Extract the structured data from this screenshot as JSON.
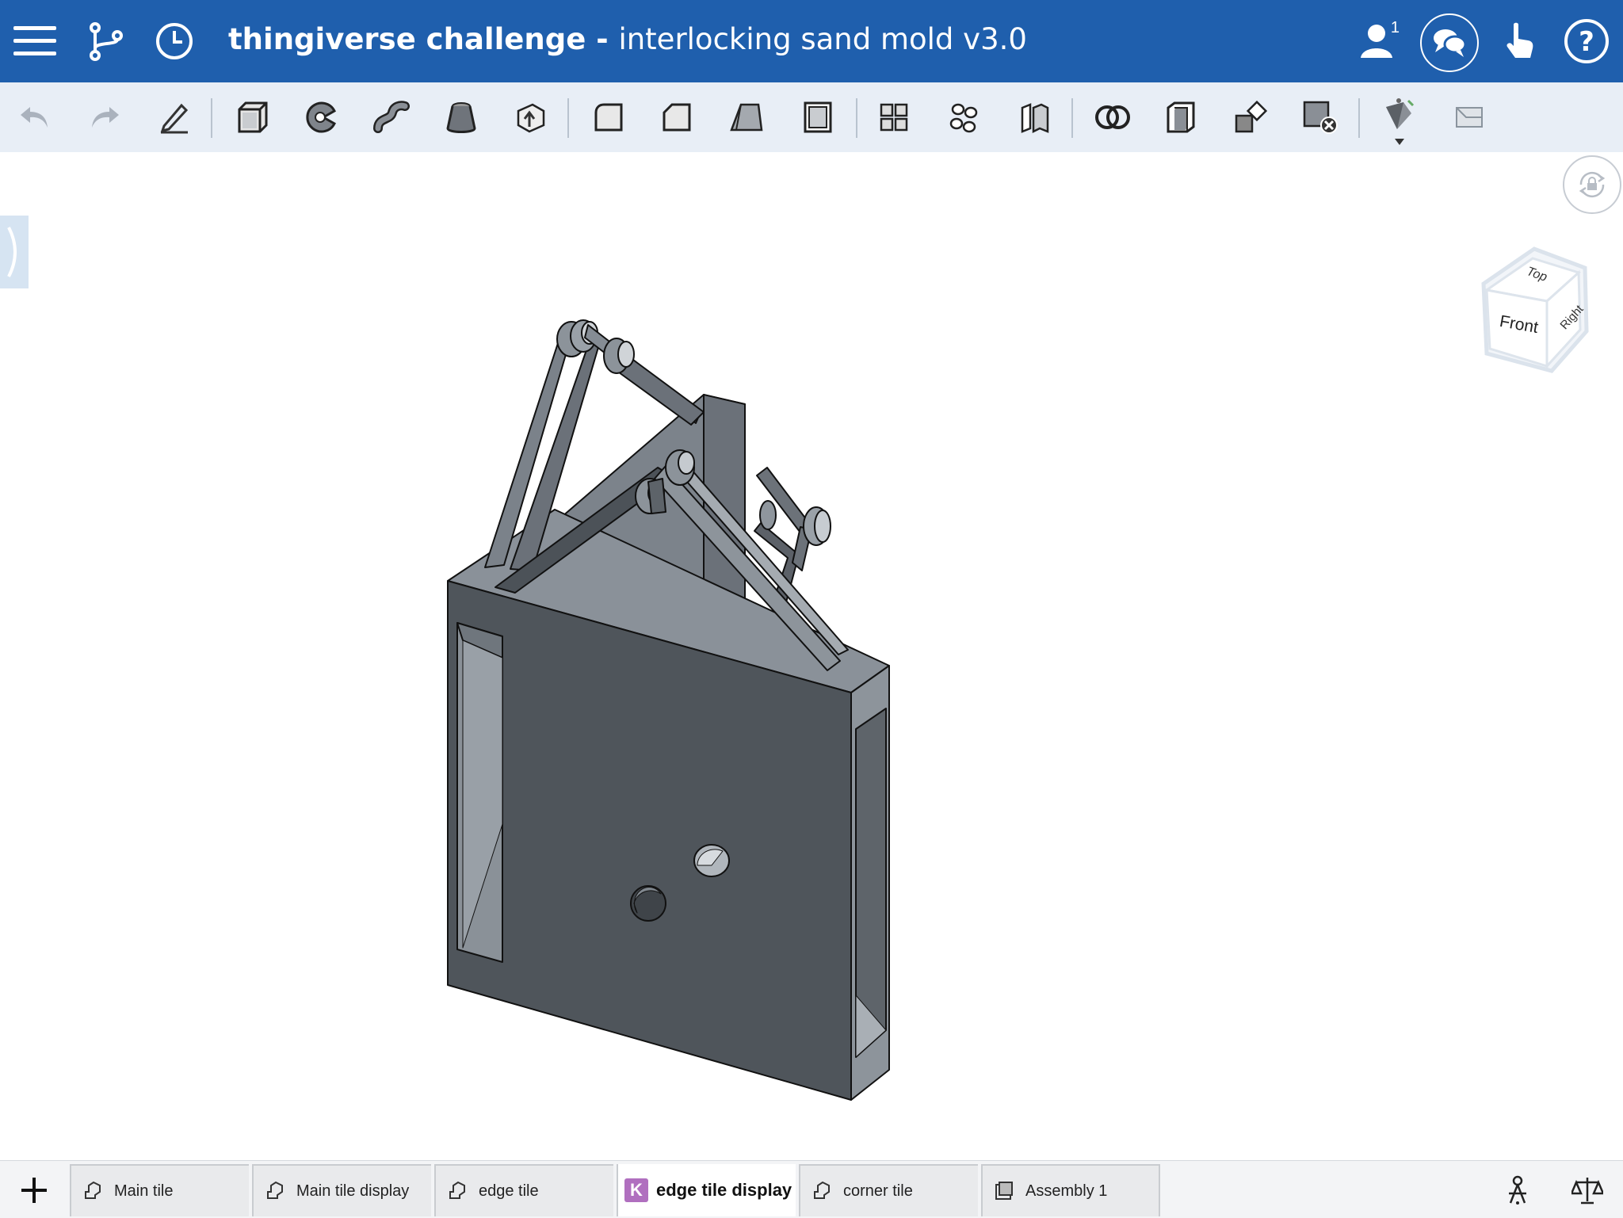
{
  "header": {
    "project_name": "thingiverse challenge",
    "separator": " - ",
    "document_name": "interlocking sand mold v3.0",
    "collaborator_count": "1",
    "icons": [
      "menu-icon",
      "branch-icon",
      "history-icon",
      "user-icon",
      "chat-icon",
      "touch-icon",
      "help-icon"
    ],
    "brand_color": "#1f5fad"
  },
  "toolbar": {
    "tools": [
      "undo",
      "redo",
      "sketch",
      "extrude",
      "revolve",
      "sweep",
      "loft",
      "thicken",
      "fillet",
      "chamfer",
      "draft",
      "shell",
      "pattern",
      "transform",
      "split",
      "boolean",
      "modify-face",
      "replace-face",
      "delete-part",
      "appearance",
      "plane"
    ]
  },
  "viewcube": {
    "top": "Top",
    "front": "Front",
    "right": "Right"
  },
  "tabs": [
    {
      "label": "Main tile",
      "type": "part-studio"
    },
    {
      "label": "Main tile display",
      "type": "part-studio"
    },
    {
      "label": "edge tile",
      "type": "part-studio"
    },
    {
      "label": "edge tile display",
      "type": "custom-feature",
      "badge": "K",
      "active": true
    },
    {
      "label": "corner tile",
      "type": "part-studio"
    },
    {
      "label": "Assembly 1",
      "type": "assembly"
    }
  ]
}
